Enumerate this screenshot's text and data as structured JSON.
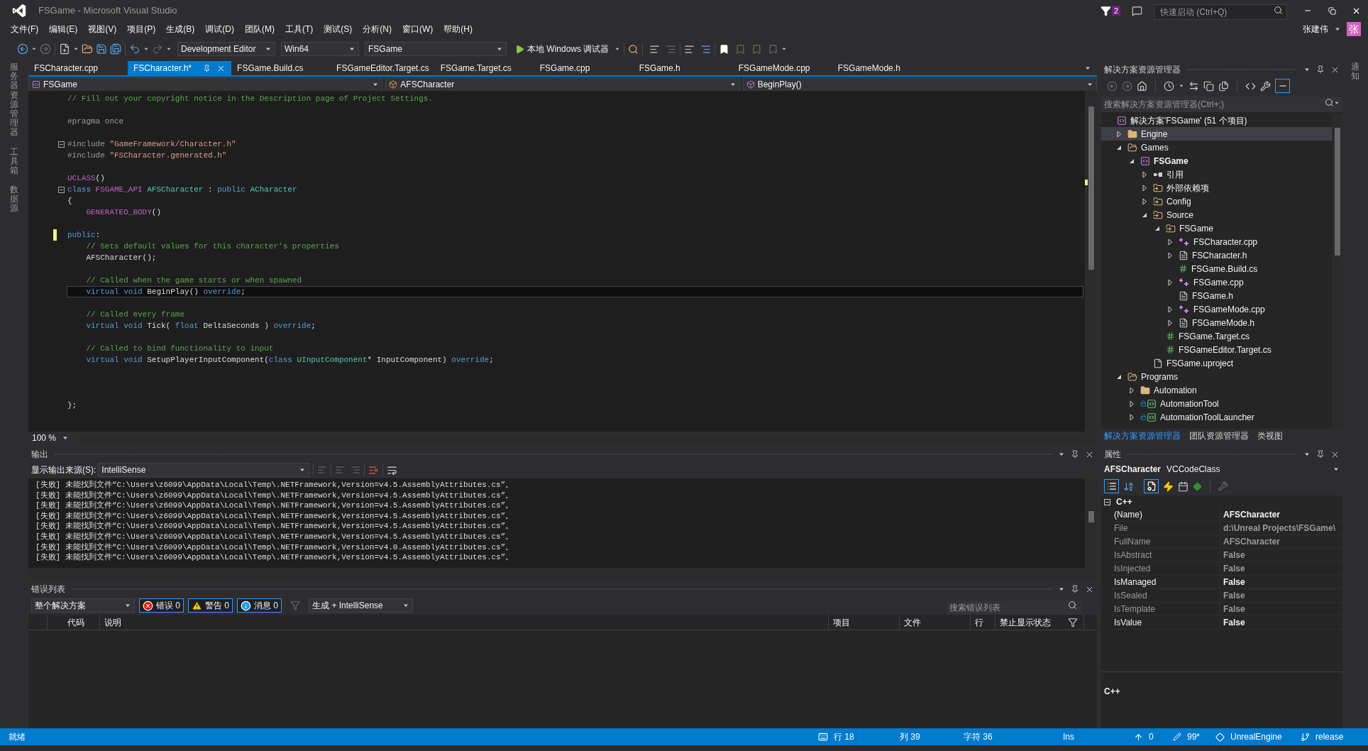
{
  "window": {
    "title": "FSGame - Microsoft Visual Studio",
    "notification_count": "2",
    "quick_launch": {
      "placeholder": "快速启动 (Ctrl+Q)"
    },
    "user": {
      "name": "张建伟",
      "avatar": "张"
    }
  },
  "menu": [
    "文件(F)",
    "编辑(E)",
    "视图(V)",
    "项目(P)",
    "生成(B)",
    "调试(D)",
    "团队(M)",
    "工具(T)",
    "测试(S)",
    "分析(N)",
    "窗口(W)",
    "帮助(H)"
  ],
  "toolbar": {
    "configuration": "Development Editor",
    "platform": "Win64",
    "startup_project": "FSGame",
    "run": "本地 Windows 调试器"
  },
  "left_rail": [
    "服务器资源管理器",
    "工具箱",
    "数据源"
  ],
  "right_rail": [
    "通知"
  ],
  "editor": {
    "tabs": [
      {
        "label": "FSCharacter.cpp",
        "selected": false
      },
      {
        "label": "FSCharacter.h*",
        "selected": true
      },
      {
        "label": "FSGame.Build.cs",
        "selected": false
      },
      {
        "label": "FSGameEditor.Target.cs",
        "selected": false
      },
      {
        "label": "FSGame.Target.cs",
        "selected": false
      },
      {
        "label": "FSGame.cpp",
        "selected": false
      },
      {
        "label": "FSGame.h",
        "selected": false
      },
      {
        "label": "FSGameMode.cpp",
        "selected": false
      },
      {
        "label": "FSGameMode.h",
        "selected": false
      }
    ],
    "nav": [
      "FSGame",
      "AFSCharacter",
      "BeginPlay()"
    ],
    "lines": [
      {
        "kind": "code",
        "changed": false,
        "current": false,
        "tokens": [
          {
            "text": "// Fill out your copyright notice in the Description page of Project Settings.",
            "kind": "comment"
          }
        ]
      },
      {
        "kind": "blank"
      },
      {
        "kind": "code",
        "changed": false,
        "current": false,
        "tokens": [
          {
            "text": "#pragma once",
            "kind": "preprocessor"
          }
        ]
      },
      {
        "kind": "blank"
      },
      {
        "kind": "code",
        "changed": false,
        "current": false,
        "fold_expanded": true,
        "tokens": [
          {
            "text": "#include ",
            "kind": "preprocessor"
          },
          {
            "text": "\"GameFramework/Character.h\"",
            "kind": "string"
          }
        ]
      },
      {
        "kind": "code",
        "changed": false,
        "current": false,
        "tokens": [
          {
            "text": "#include ",
            "kind": "preprocessor"
          },
          {
            "text": "\"FSCharacter.generated.h\"",
            "kind": "string"
          }
        ]
      },
      {
        "kind": "blank"
      },
      {
        "kind": "code",
        "changed": false,
        "current": false,
        "tokens": [
          {
            "text": "UCLASS",
            "kind": "macro"
          },
          {
            "text": "()",
            "kind": "plain"
          }
        ]
      },
      {
        "kind": "code",
        "changed": false,
        "current": false,
        "fold_expanded": true,
        "tokens": [
          {
            "text": "class ",
            "kind": "keyword"
          },
          {
            "text": "FSGAME_API ",
            "kind": "macro"
          },
          {
            "text": "AFSCharacter",
            "kind": "type"
          },
          {
            "text": " : ",
            "kind": "plain"
          },
          {
            "text": "public ",
            "kind": "keyword"
          },
          {
            "text": "ACharacter",
            "kind": "type"
          }
        ]
      },
      {
        "kind": "code",
        "changed": false,
        "current": false,
        "tokens": [
          {
            "text": "{",
            "kind": "plain"
          }
        ]
      },
      {
        "kind": "code",
        "changed": false,
        "current": false,
        "tokens": [
          {
            "text": "    GENERATED_BODY",
            "kind": "macro"
          },
          {
            "text": "()",
            "kind": "plain"
          }
        ]
      },
      {
        "kind": "blank"
      },
      {
        "kind": "code",
        "changed": true,
        "current": false,
        "tokens": [
          {
            "text": "public",
            "kind": "keyword"
          },
          {
            "text": ":",
            "kind": "plain"
          }
        ]
      },
      {
        "kind": "code",
        "changed": false,
        "current": false,
        "tokens": [
          {
            "text": "    // Sets default values for this character's properties",
            "kind": "comment"
          }
        ]
      },
      {
        "kind": "code",
        "changed": false,
        "current": false,
        "tokens": [
          {
            "text": "    AFSCharacter();",
            "kind": "plain"
          }
        ]
      },
      {
        "kind": "blank"
      },
      {
        "kind": "code",
        "changed": false,
        "current": false,
        "tokens": [
          {
            "text": "    // Called when the game starts or when spawned",
            "kind": "comment"
          }
        ]
      },
      {
        "kind": "code",
        "changed": false,
        "current": true,
        "tokens": [
          {
            "text": "    virtual void ",
            "kind": "keyword"
          },
          {
            "text": "BeginPlay() ",
            "kind": "plain"
          },
          {
            "text": "override",
            "kind": "keyword"
          },
          {
            "text": ";",
            "kind": "plain"
          }
        ]
      },
      {
        "kind": "blank"
      },
      {
        "kind": "code",
        "changed": false,
        "current": false,
        "tokens": [
          {
            "text": "    // Called every frame",
            "kind": "comment"
          }
        ]
      },
      {
        "kind": "code",
        "changed": false,
        "current": false,
        "tokens": [
          {
            "text": "    virtual void ",
            "kind": "keyword"
          },
          {
            "text": "Tick( ",
            "kind": "plain"
          },
          {
            "text": "float",
            "kind": "keyword"
          },
          {
            "text": " DeltaSeconds ) ",
            "kind": "plain"
          },
          {
            "text": "override",
            "kind": "keyword"
          },
          {
            "text": ";",
            "kind": "plain"
          }
        ]
      },
      {
        "kind": "blank"
      },
      {
        "kind": "code",
        "changed": false,
        "current": false,
        "tokens": [
          {
            "text": "    // Called to bind functionality to input",
            "kind": "comment"
          }
        ]
      },
      {
        "kind": "code",
        "changed": false,
        "current": false,
        "tokens": [
          {
            "text": "    virtual void ",
            "kind": "keyword"
          },
          {
            "text": "SetupPlayerInputComponent(",
            "kind": "plain"
          },
          {
            "text": "class ",
            "kind": "keyword"
          },
          {
            "text": "UInputComponent",
            "kind": "type"
          },
          {
            "text": "* InputComponent) ",
            "kind": "plain"
          },
          {
            "text": "override",
            "kind": "keyword"
          },
          {
            "text": ";",
            "kind": "plain"
          }
        ]
      },
      {
        "kind": "blank"
      },
      {
        "kind": "blank"
      },
      {
        "kind": "blank"
      },
      {
        "kind": "code",
        "changed": false,
        "current": false,
        "tokens": [
          {
            "text": "};",
            "kind": "plain"
          }
        ]
      }
    ],
    "zoom": "100 %"
  },
  "output": {
    "title": "输出",
    "source_label": "显示输出来源(S):",
    "source": "IntelliSense",
    "lines": [
      "[失败] 未能找到文件“C:\\Users\\z6099\\AppData\\Local\\Temp\\.NETFramework,Version=v4.5.AssemblyAttributes.cs”。",
      "[失败] 未能找到文件“C:\\Users\\z6099\\AppData\\Local\\Temp\\.NETFramework,Version=v4.5.AssemblyAttributes.cs”。",
      "[失败] 未能找到文件“C:\\Users\\z6099\\AppData\\Local\\Temp\\.NETFramework,Version=v4.5.AssemblyAttributes.cs”。",
      "[失败] 未能找到文件“C:\\Users\\z6099\\AppData\\Local\\Temp\\.NETFramework,Version=v4.5.AssemblyAttributes.cs”。",
      "[失败] 未能找到文件“C:\\Users\\z6099\\AppData\\Local\\Temp\\.NETFramework,Version=v4.5.AssemblyAttributes.cs”。",
      "[失败] 未能找到文件“C:\\Users\\z6099\\AppData\\Local\\Temp\\.NETFramework,Version=v4.5.AssemblyAttributes.cs”。",
      "[失败] 未能找到文件“C:\\Users\\z6099\\AppData\\Local\\Temp\\.NETFramework,Version=v4.0.AssemblyAttributes.cs”。",
      "[失败] 未能找到文件“C:\\Users\\z6099\\AppData\\Local\\Temp\\.NETFramework,Version=v4.5.AssemblyAttributes.cs”。"
    ]
  },
  "error_list": {
    "title": "错误列表",
    "scope": "整个解决方案",
    "filters": [
      {
        "kind": "error",
        "label": "错误 0",
        "selected": true
      },
      {
        "kind": "warning",
        "label": "警告 0",
        "selected": true
      },
      {
        "kind": "message",
        "label": "消息 0",
        "selected": true
      }
    ],
    "source": "生成 + IntelliSense",
    "search": {
      "placeholder": "搜索错误列表"
    },
    "columns": [
      "代码",
      "说明",
      "项目",
      "文件",
      "行",
      "禁止显示状态"
    ]
  },
  "solution_explorer": {
    "title": "解决方案资源管理器",
    "search": {
      "placeholder": "搜索解决方案资源管理器(Ctrl+;)"
    },
    "tree": {
      "label": "解决方案'FSGame' (51 个项目)",
      "kind": "solution",
      "selected": false,
      "children": [
        {
          "label": "Engine",
          "kind": "folder",
          "expanded": false,
          "selected": true
        },
        {
          "label": "Games",
          "kind": "folder_open",
          "expanded": true,
          "selected": false,
          "children": [
            {
              "label": "FSGame",
              "kind": "project",
              "expanded": true,
              "selected": false,
              "children": [
                {
                  "label": "引用",
                  "kind": "references",
                  "expanded": false,
                  "selected": false
                },
                {
                  "label": "外部依赖项",
                  "kind": "dependencies",
                  "expanded": false,
                  "selected": false
                },
                {
                  "label": "Config",
                  "kind": "filter",
                  "expanded": false,
                  "selected": false
                },
                {
                  "label": "Source",
                  "kind": "filter",
                  "expanded": true,
                  "selected": false,
                  "children": [
                    {
                      "label": "FSGame",
                      "kind": "filter",
                      "expanded": true,
                      "selected": false,
                      "children": [
                        {
                          "label": "FSCharacter.cpp",
                          "kind": "cpp",
                          "expanded": false,
                          "selected": false
                        },
                        {
                          "label": "FSCharacter.h",
                          "kind": "header",
                          "expanded": false,
                          "selected": false
                        },
                        {
                          "label": "FSGame.Build.cs",
                          "kind": "csharp",
                          "selected": false
                        },
                        {
                          "label": "FSGame.cpp",
                          "kind": "cpp",
                          "expanded": false,
                          "selected": false
                        },
                        {
                          "label": "FSGame.h",
                          "kind": "header",
                          "selected": false
                        },
                        {
                          "label": "FSGameMode.cpp",
                          "kind": "cpp",
                          "expanded": false,
                          "selected": false
                        },
                        {
                          "label": "FSGameMode.h",
                          "kind": "header",
                          "expanded": false,
                          "selected": false
                        }
                      ]
                    },
                    {
                      "label": "FSGame.Target.cs",
                      "kind": "csharp",
                      "selected": false
                    },
                    {
                      "label": "FSGameEditor.Target.cs",
                      "kind": "csharp",
                      "selected": false
                    }
                  ]
                },
                {
                  "label": "FSGame.uproject",
                  "kind": "file",
                  "selected": false
                }
              ]
            }
          ]
        },
        {
          "label": "Programs",
          "kind": "folder_open",
          "expanded": true,
          "selected": false,
          "children": [
            {
              "label": "Automation",
              "kind": "folder",
              "expanded": false,
              "selected": false
            },
            {
              "label": "AutomationTool",
              "kind": "csproject",
              "expanded": false,
              "selected": false
            },
            {
              "label": "AutomationToolLauncher",
              "kind": "csproject",
              "expanded": false,
              "selected": false
            }
          ]
        }
      ]
    },
    "tabs": [
      {
        "label": "解决方案资源管理器",
        "selected": true
      },
      {
        "label": "团队资源管理器",
        "selected": false
      },
      {
        "label": "类视图",
        "selected": false
      }
    ]
  },
  "properties": {
    "title": "属性",
    "object": {
      "name": "AFSCharacter",
      "type": "VCCodeClass"
    },
    "category": {
      "label": "C++",
      "expanded": true
    },
    "rows": [
      {
        "name": "(Name)",
        "value": "AFSCharacter",
        "read_only": false
      },
      {
        "name": "File",
        "value": "d:\\Unreal Projects\\FSGame\\",
        "read_only": true
      },
      {
        "name": "FullName",
        "value": "AFSCharacter",
        "read_only": true
      },
      {
        "name": "IsAbstract",
        "value": "False",
        "read_only": true
      },
      {
        "name": "IsInjected",
        "value": "False",
        "read_only": true
      },
      {
        "name": "IsManaged",
        "value": "False",
        "read_only": false
      },
      {
        "name": "IsSealed",
        "value": "False",
        "read_only": true
      },
      {
        "name": "IsTemplate",
        "value": "False",
        "read_only": true
      },
      {
        "name": "IsValue",
        "value": "False",
        "read_only": false
      }
    ],
    "description": "C++"
  },
  "status_bar": {
    "state": "就绪",
    "line": "行 18",
    "column": "列 39",
    "char": "字符 36",
    "mode": "Ins",
    "push_count": "0",
    "changes": "99*",
    "repo": "UnrealEngine",
    "branch": "release"
  }
}
